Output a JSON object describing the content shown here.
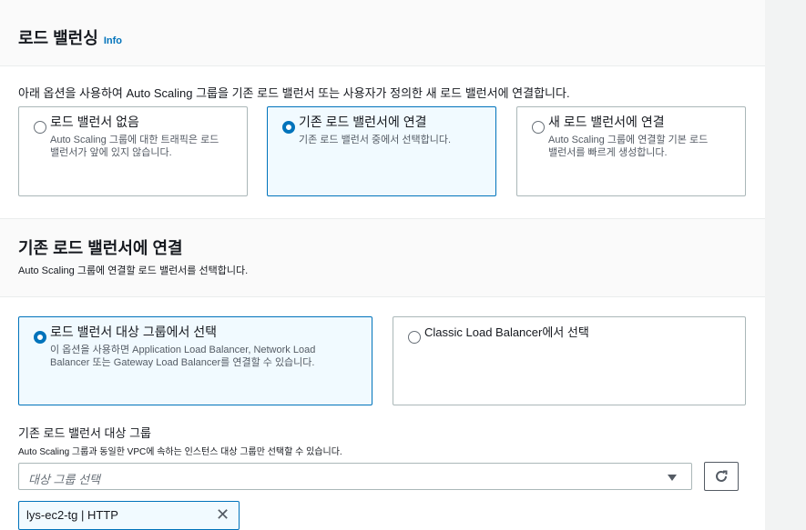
{
  "load_balancing": {
    "title": "로드 밸런싱",
    "info": "Info",
    "description": "아래 옵션을 사용하여 Auto Scaling 그룹을 기존 로드 밸런서 또는 사용자가 정의한 새 로드 밸런서에 연결합니다.",
    "options": [
      {
        "title": "로드 밸런서 없음",
        "desc": "Auto Scaling 그룹에 대한 트래픽은 로드 밸런서가 앞에 있지 않습니다.",
        "selected": false
      },
      {
        "title": "기존 로드 밸런서에 연결",
        "desc": "기존 로드 밸런서 중에서 선택합니다.",
        "selected": true
      },
      {
        "title": "새 로드 밸런서에 연결",
        "desc": "Auto Scaling 그룹에 연결할 기본 로드 밸런서를 빠르게 생성합니다.",
        "selected": false
      }
    ]
  },
  "attach_existing": {
    "title": "기존 로드 밸런서에 연결",
    "subtitle": "Auto Scaling 그룹에 연결할 로드 밸런서를 선택합니다.",
    "options": [
      {
        "title": "로드 밸런서 대상 그룹에서 선택",
        "desc": "이 옵션을 사용하면 Application Load Balancer, Network Load Balancer 또는 Gateway Load Balancer를 연결할 수 있습니다.",
        "selected": true
      },
      {
        "title": "Classic Load Balancer에서 선택",
        "desc": "",
        "selected": false
      }
    ],
    "target_group_label": "기존 로드 밸런서 대상 그룹",
    "target_group_hint": "Auto Scaling 그룹과 동일한 VPC에 속하는 인스턴스 대상 그룹만 선택할 수 있습니다.",
    "select_placeholder": "대상 그룹 선택",
    "selected_token": "lys-ec2-tg | HTTP"
  },
  "colors": {
    "accent": "#0073bb",
    "selected_bg": "#f1faff",
    "border": "#aab7b8"
  },
  "icons": [
    "radio-icon",
    "caret-down-icon",
    "refresh-icon",
    "close-icon"
  ]
}
